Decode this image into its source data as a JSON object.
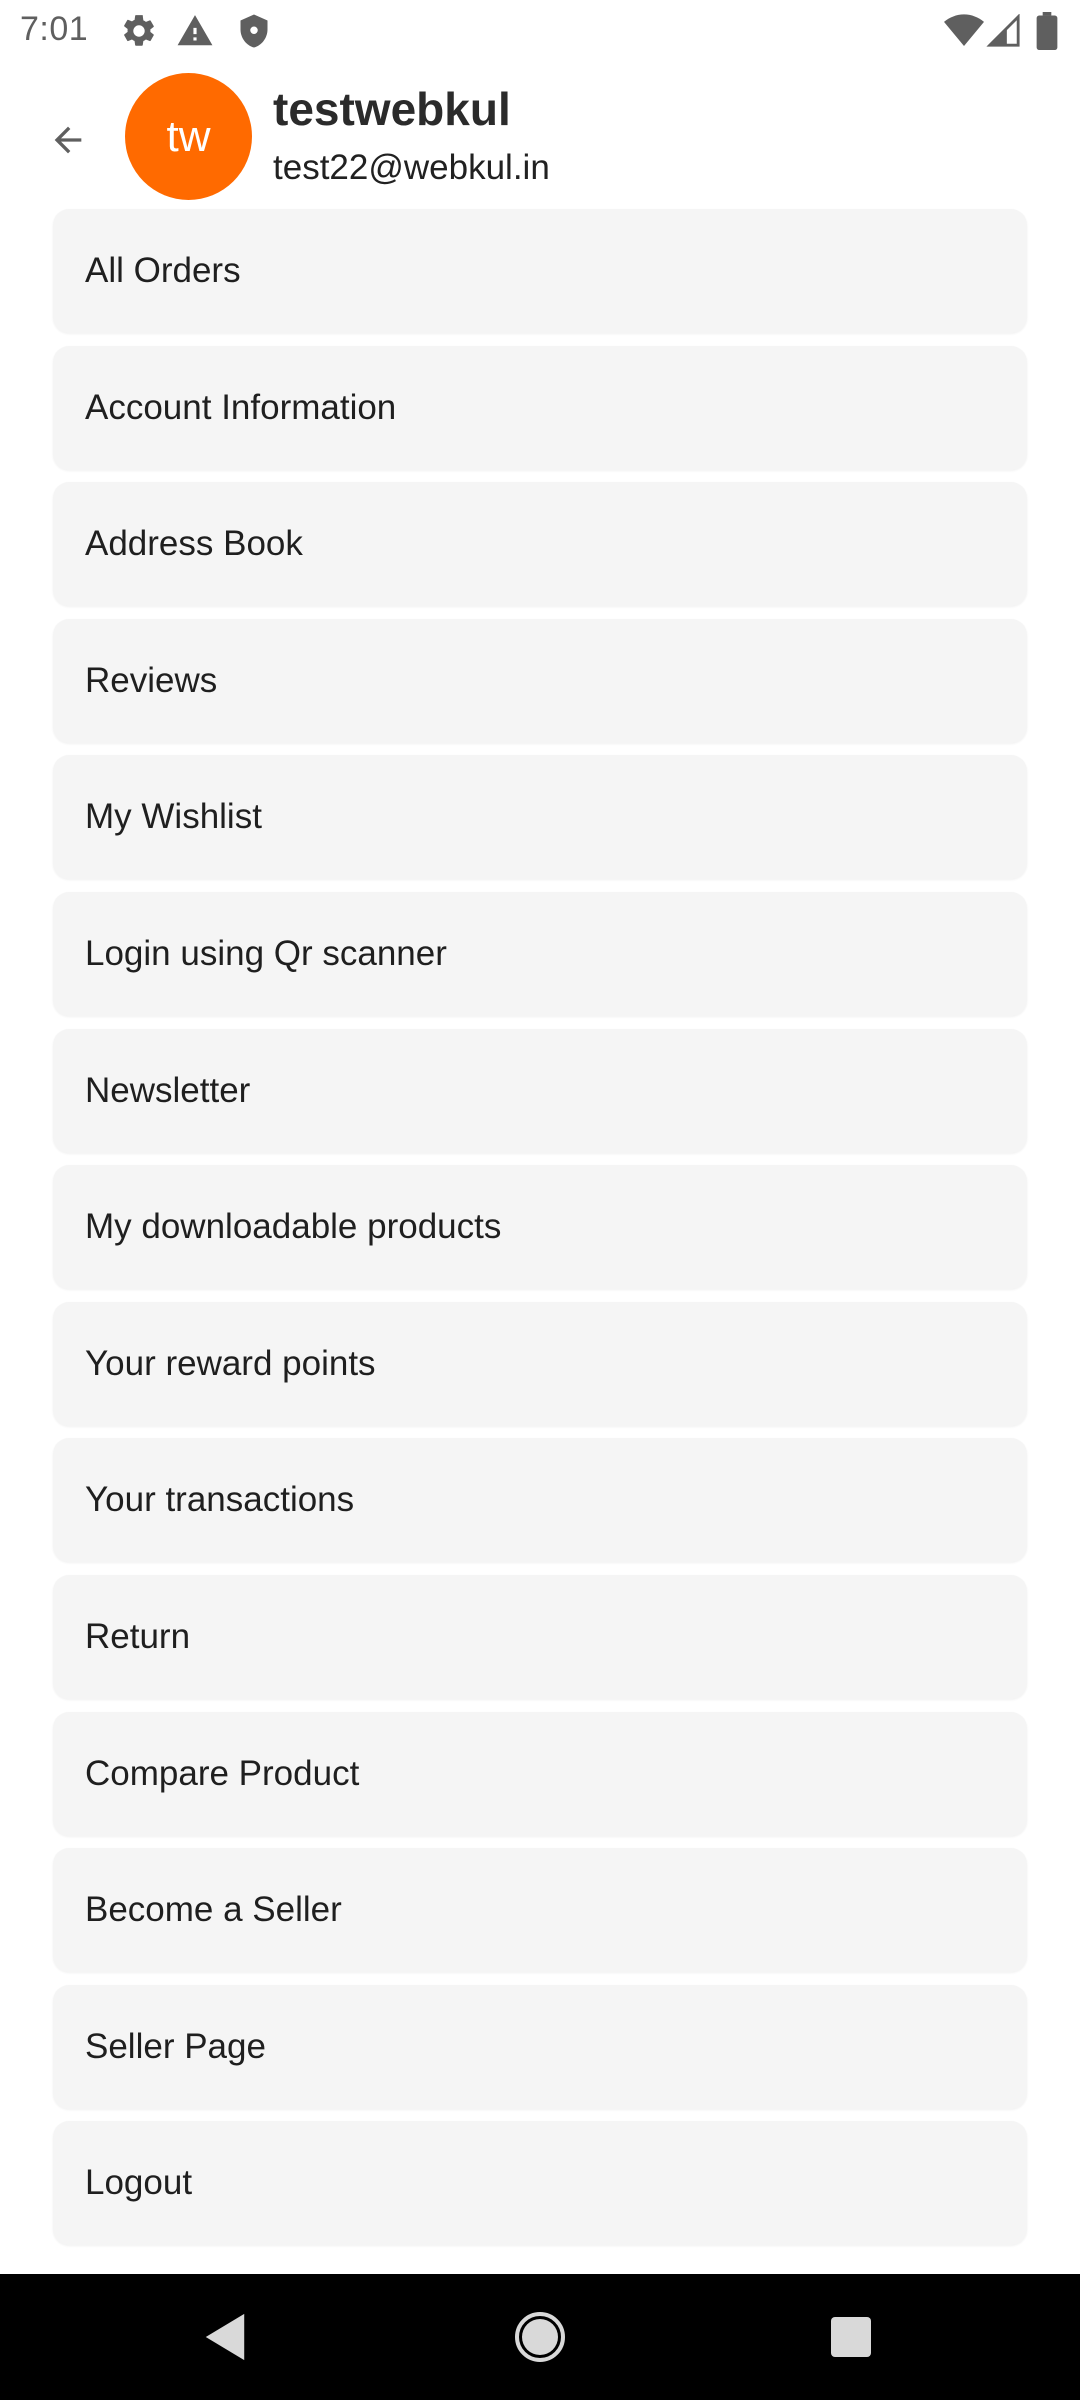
{
  "status_bar": {
    "time": "7:01",
    "icons_left": [
      "settings-icon",
      "warning-icon",
      "shield-icon"
    ],
    "icons_right": [
      "wifi-icon",
      "signal-icon",
      "battery-icon"
    ]
  },
  "header": {
    "avatar_initials": "tw",
    "avatar_color": "#ff6a00",
    "user_name": "testwebkul",
    "user_email": "test22@webkul.in"
  },
  "menu": {
    "items": [
      {
        "label": "All Orders"
      },
      {
        "label": "Account Information"
      },
      {
        "label": "Address Book"
      },
      {
        "label": "Reviews"
      },
      {
        "label": "My Wishlist"
      },
      {
        "label": "Login using Qr scanner"
      },
      {
        "label": "Newsletter"
      },
      {
        "label": "My downloadable products"
      },
      {
        "label": "Your reward points"
      },
      {
        "label": "Your transactions"
      },
      {
        "label": "Return"
      },
      {
        "label": "Compare Product"
      },
      {
        "label": "Become a Seller"
      },
      {
        "label": "Seller Page"
      },
      {
        "label": "Logout"
      }
    ]
  },
  "nav_bar": {
    "buttons": [
      "back-triangle-icon",
      "home-circle-icon",
      "recents-square-icon"
    ]
  }
}
